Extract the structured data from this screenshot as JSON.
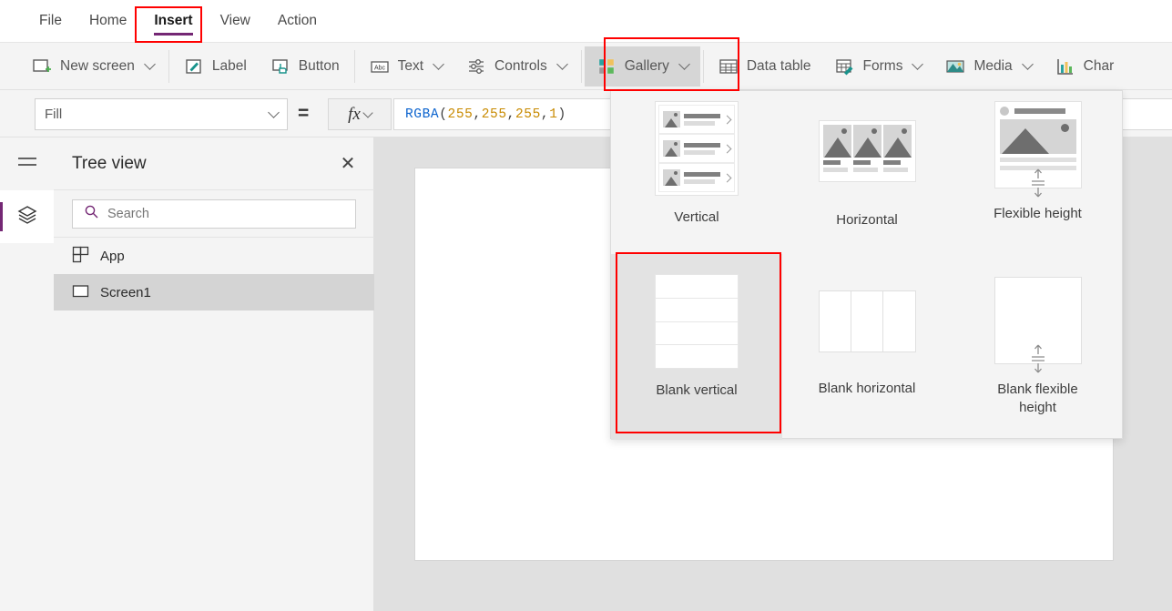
{
  "menubar": {
    "items": [
      {
        "label": "File",
        "active": false
      },
      {
        "label": "Home",
        "active": false
      },
      {
        "label": "Insert",
        "active": true
      },
      {
        "label": "View",
        "active": false
      },
      {
        "label": "Action",
        "active": false
      }
    ]
  },
  "ribbon": {
    "items": [
      {
        "label": "New screen",
        "icon": "new-screen-icon",
        "caret": true
      },
      {
        "label": "Label",
        "icon": "label-icon",
        "caret": false
      },
      {
        "label": "Button",
        "icon": "button-icon",
        "caret": false
      },
      {
        "label": "Text",
        "icon": "text-icon",
        "caret": true
      },
      {
        "label": "Controls",
        "icon": "controls-icon",
        "caret": true
      },
      {
        "label": "Gallery",
        "icon": "gallery-icon",
        "caret": true,
        "selected": true
      },
      {
        "label": "Data table",
        "icon": "data-table-icon",
        "caret": false
      },
      {
        "label": "Forms",
        "icon": "forms-icon",
        "caret": true
      },
      {
        "label": "Media",
        "icon": "media-icon",
        "caret": true
      },
      {
        "label": "Char",
        "icon": "charts-icon",
        "caret": false
      }
    ]
  },
  "formula_bar": {
    "property": "Fill",
    "equals": "=",
    "fx_label": "fx",
    "formula": {
      "function": "RGBA",
      "open": "(",
      "args": [
        "255",
        "255",
        "255",
        "1"
      ],
      "separator": ", ",
      "close": ")",
      "full_text": "RGBA(255, 255, 255, 1)"
    }
  },
  "rail": {
    "hamburger": "hamburger-icon",
    "tree_view_button": "layers-icon"
  },
  "treeview": {
    "title": "Tree view",
    "close": "✕",
    "search_placeholder": "Search",
    "search_value": "",
    "rows": [
      {
        "label": "App",
        "icon": "app-icon",
        "selected": false
      },
      {
        "label": "Screen1",
        "icon": "screen-icon",
        "selected": true
      }
    ]
  },
  "gallery_flyout": {
    "items": [
      {
        "label": "Vertical",
        "type": "vertical",
        "selected": false
      },
      {
        "label": "Horizontal",
        "type": "horizontal",
        "selected": false
      },
      {
        "label": "Flexible height",
        "type": "flexible",
        "selected": false
      },
      {
        "label": "Blank vertical",
        "type": "blank-vertical",
        "selected": true
      },
      {
        "label": "Blank horizontal",
        "type": "blank-horizontal",
        "selected": false
      },
      {
        "label": "Blank flexible height",
        "type": "blank-flexible",
        "selected": false
      }
    ]
  },
  "colors": {
    "accent_purple": "#742774",
    "annotation_red": "#ff0000",
    "ribbon_bg": "#f4f4f4",
    "canvas_bg": "#e0e0e0",
    "selected_row": "#d4d4d4",
    "icon_teal": "#18938c",
    "icon_green": "#4caf50",
    "icon_orange": "#e8a33d"
  }
}
